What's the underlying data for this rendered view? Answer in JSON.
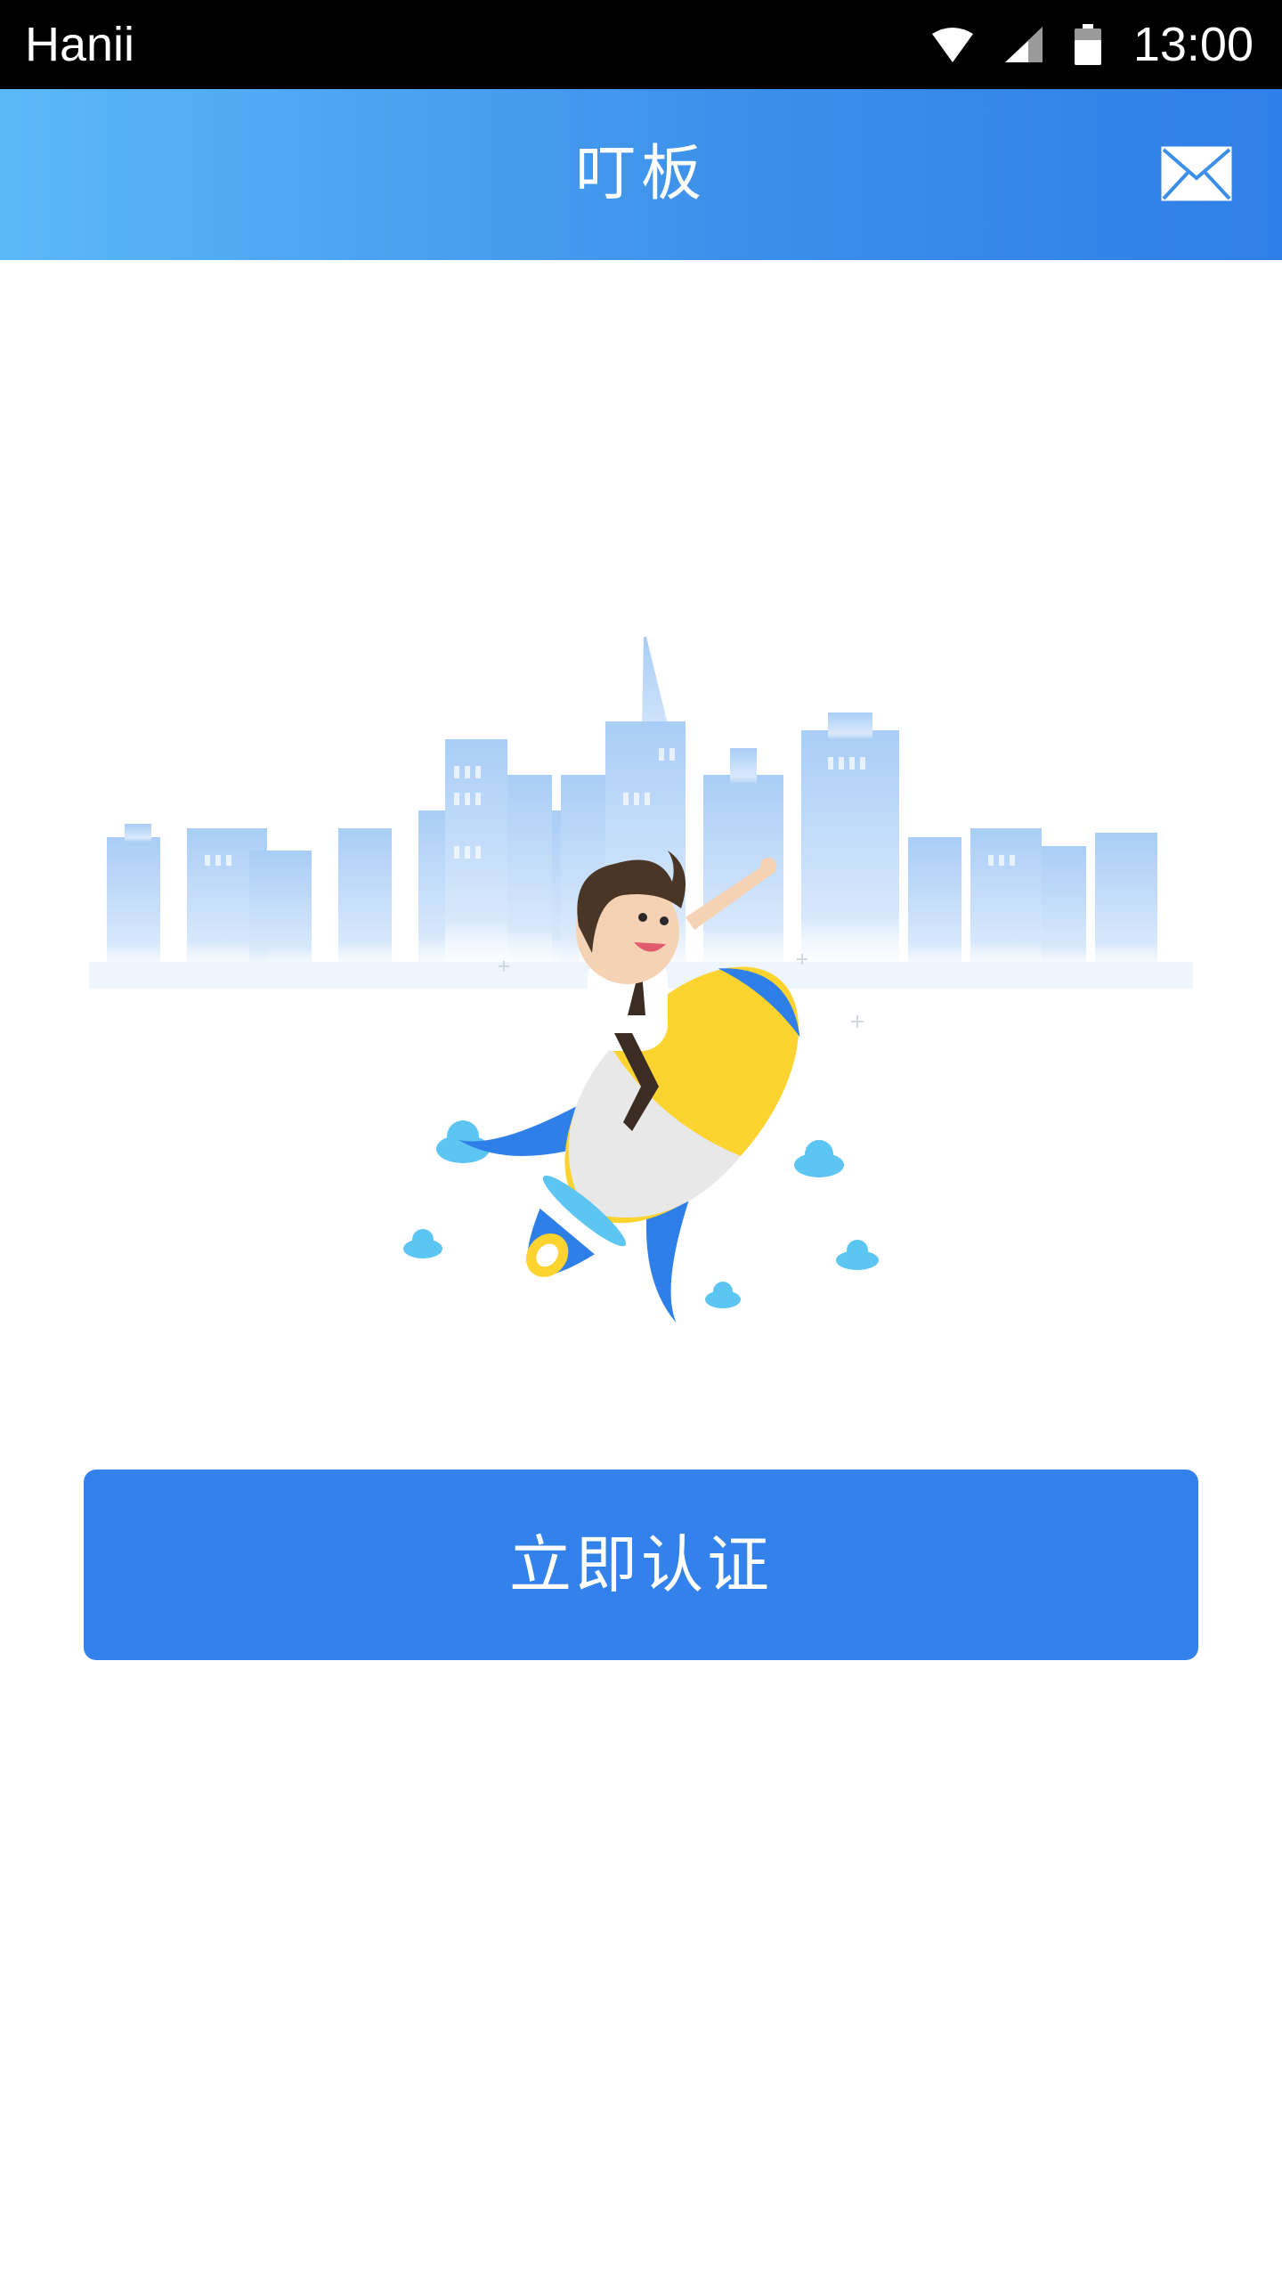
{
  "status_bar": {
    "carrier": "Hanii",
    "time": "13:00",
    "icons": [
      "wifi-icon",
      "cellular-signal-icon",
      "battery-icon"
    ]
  },
  "app_bar": {
    "title": "叮板",
    "action_icon": "mail-icon"
  },
  "hero": {
    "illustration": "city-skyline-with-person-riding-rocket"
  },
  "actions": {
    "verify_button_label": "立即认证"
  },
  "colors": {
    "status_bar_bg": "#000000",
    "app_bar_gradient_start": "#5bb8f8",
    "app_bar_gradient_end": "#2f7fe8",
    "primary_button": "#3381ea",
    "skyline": "#bcd9f7",
    "rocket_yellow": "#fdd330",
    "rocket_blue": "#2f7fe8",
    "cloud": "#5cc5f2"
  }
}
